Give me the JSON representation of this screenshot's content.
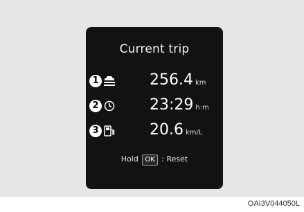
{
  "display": {
    "title": "Current trip",
    "rows": [
      {
        "index": "1",
        "icon": "distance-car-icon",
        "value": "256.4",
        "unit": "km"
      },
      {
        "index": "2",
        "icon": "clock-icon",
        "value": "23:29",
        "unit": "h:m"
      },
      {
        "index": "3",
        "icon": "fuel-pump-icon",
        "value": "20.6",
        "unit": "km/L"
      }
    ],
    "hold_prefix": "Hold",
    "ok_key": "OK",
    "hold_suffix": ": Reset"
  },
  "figure_code": "OAI3V044050L",
  "colors": {
    "screen": "#121212",
    "panel": "#e6e6e6",
    "text": "#ffffff"
  }
}
